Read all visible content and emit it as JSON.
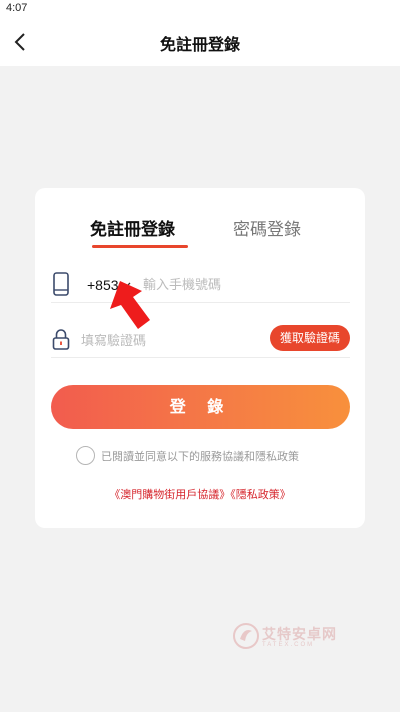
{
  "status_bar": {
    "time": "4:07"
  },
  "header": {
    "title": "免註冊登錄"
  },
  "tabs": {
    "sms_login": "免註冊登錄",
    "password_login": "密碼登錄"
  },
  "phone": {
    "country_code": "+853",
    "placeholder": "輸入手機號碼"
  },
  "code": {
    "placeholder": "填寫驗證碼",
    "get_code_label": "獲取驗證碼"
  },
  "login_button": "登 錄",
  "agreement": {
    "text": "已閱讀並同意以下的服務協議和隱私政策",
    "terms_link": "《澳門購物街用戶協議》",
    "privacy_link": "《隱私政策》"
  },
  "watermark": {
    "text": "艾特安卓网",
    "subtext": "TATEX.COM"
  },
  "colors": {
    "accent": "#e8462c",
    "gradient_end": "#f8903c",
    "link": "#d6262d"
  }
}
